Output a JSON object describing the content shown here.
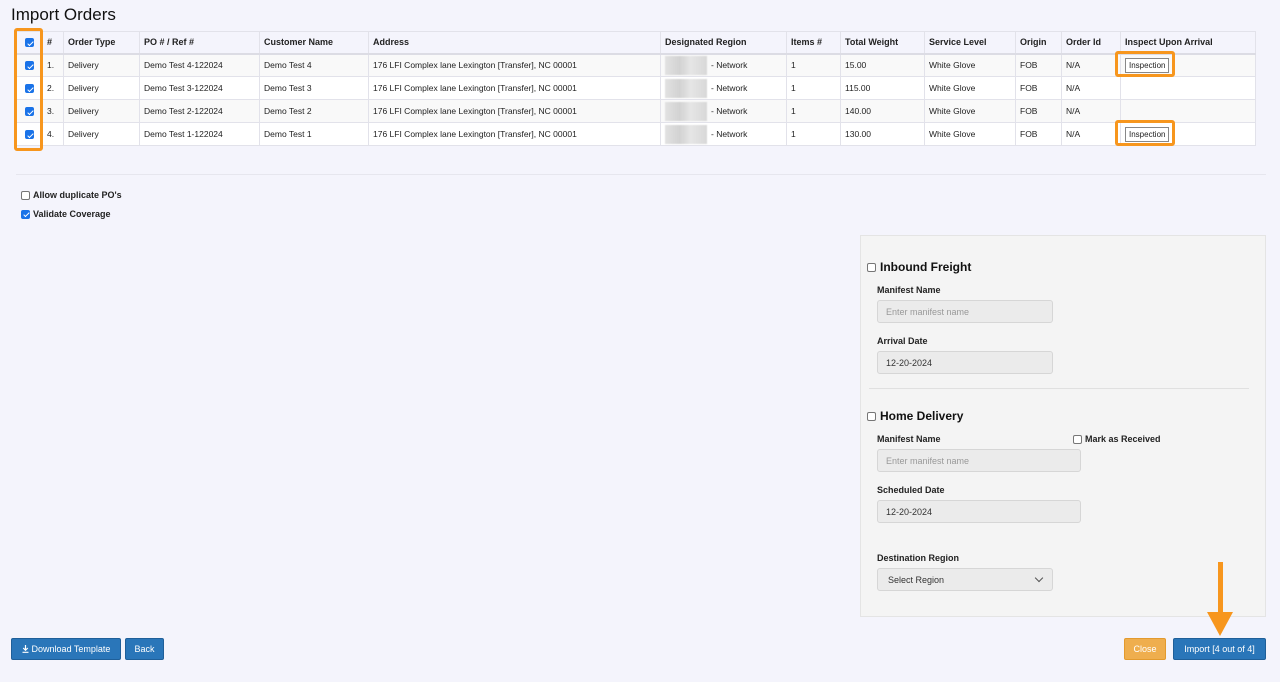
{
  "page": {
    "title": "Import Orders"
  },
  "table": {
    "headers": [
      "#",
      "Order Type",
      "PO # / Ref #",
      "Customer Name",
      "Address",
      "Designated Region",
      "Items #",
      "Total Weight",
      "Service Level",
      "Origin",
      "Order Id",
      "Inspect Upon Arrival"
    ],
    "select_all_checked": true,
    "rows": [
      {
        "checked": true,
        "num": "1.",
        "order_type": "Delivery",
        "po": "Demo Test 4-122024",
        "customer": "Demo Test 4",
        "address": "176 LFI Complex lane Lexington [Transfer], NC 00001",
        "region": "- Network",
        "items": "1",
        "weight": "15.00",
        "service": "White Glove",
        "origin": "FOB",
        "order_id": "N/A",
        "inspect": "Inspection"
      },
      {
        "checked": true,
        "num": "2.",
        "order_type": "Delivery",
        "po": "Demo Test 3-122024",
        "customer": "Demo Test 3",
        "address": "176 LFI Complex lane Lexington [Transfer], NC 00001",
        "region": "- Network",
        "items": "1",
        "weight": "115.00",
        "service": "White Glove",
        "origin": "FOB",
        "order_id": "N/A",
        "inspect": ""
      },
      {
        "checked": true,
        "num": "3.",
        "order_type": "Delivery",
        "po": "Demo Test 2-122024",
        "customer": "Demo Test 2",
        "address": "176 LFI Complex lane Lexington [Transfer], NC 00001",
        "region": "- Network",
        "items": "1",
        "weight": "140.00",
        "service": "White Glove",
        "origin": "FOB",
        "order_id": "N/A",
        "inspect": ""
      },
      {
        "checked": true,
        "num": "4.",
        "order_type": "Delivery",
        "po": "Demo Test 1-122024",
        "customer": "Demo Test 1",
        "address": "176 LFI Complex lane Lexington [Transfer], NC 00001",
        "region": "- Network",
        "items": "1",
        "weight": "130.00",
        "service": "White Glove",
        "origin": "FOB",
        "order_id": "N/A",
        "inspect": "Inspection"
      }
    ]
  },
  "options": {
    "allow_duplicate": {
      "label": "Allow duplicate PO's",
      "checked": false
    },
    "validate_coverage": {
      "label": "Validate Coverage",
      "checked": true
    }
  },
  "inbound": {
    "title": "Inbound Freight",
    "checked": false,
    "manifest_label": "Manifest Name",
    "manifest_placeholder": "Enter manifest name",
    "date_label": "Arrival Date",
    "date_value": "12-20-2024"
  },
  "home": {
    "title": "Home Delivery",
    "checked": false,
    "manifest_label": "Manifest Name",
    "manifest_placeholder": "Enter manifest name",
    "received_label": "Mark as Received",
    "received_checked": false,
    "date_label": "Scheduled Date",
    "date_value": "12-20-2024",
    "region_label": "Destination Region",
    "region_selected": "Select Region"
  },
  "buttons": {
    "download": "Download Template",
    "back": "Back",
    "close": "Close",
    "import": "Import [4 out of 4]"
  },
  "colors": {
    "highlight": "#f7961d",
    "primary_button": "#2a76b9",
    "close_button": "#efae4e",
    "checkbox": "#1a73e8"
  }
}
